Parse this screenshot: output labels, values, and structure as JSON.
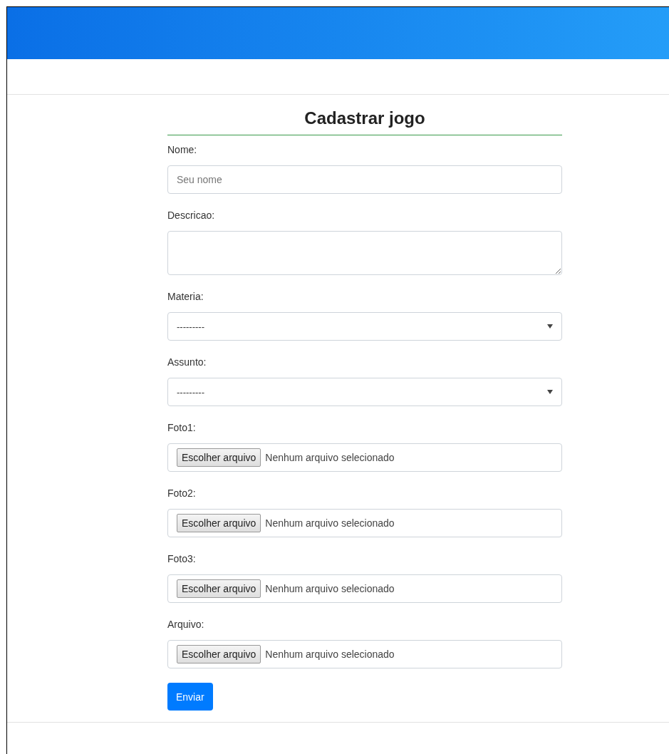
{
  "form": {
    "title": "Cadastrar jogo",
    "fields": [
      {
        "kind": "text",
        "label": "Nome:",
        "placeholder": "Seu nome"
      },
      {
        "kind": "textarea",
        "label": "Descricao:"
      },
      {
        "kind": "select",
        "label": "Materia:",
        "value": "---------"
      },
      {
        "kind": "select",
        "label": "Assunto:",
        "value": "---------"
      },
      {
        "kind": "file",
        "label": "Foto1:",
        "button": "Escolher arquivo",
        "status": "Nenhum arquivo selecionado"
      },
      {
        "kind": "file",
        "label": "Foto2:",
        "button": "Escolher arquivo",
        "status": "Nenhum arquivo selecionado"
      },
      {
        "kind": "file",
        "label": "Foto3:",
        "button": "Escolher arquivo",
        "status": "Nenhum arquivo selecionado"
      },
      {
        "kind": "file",
        "label": "Arquivo:",
        "button": "Escolher arquivo",
        "status": "Nenhum arquivo selecionado"
      }
    ],
    "submit": "Enviar"
  }
}
